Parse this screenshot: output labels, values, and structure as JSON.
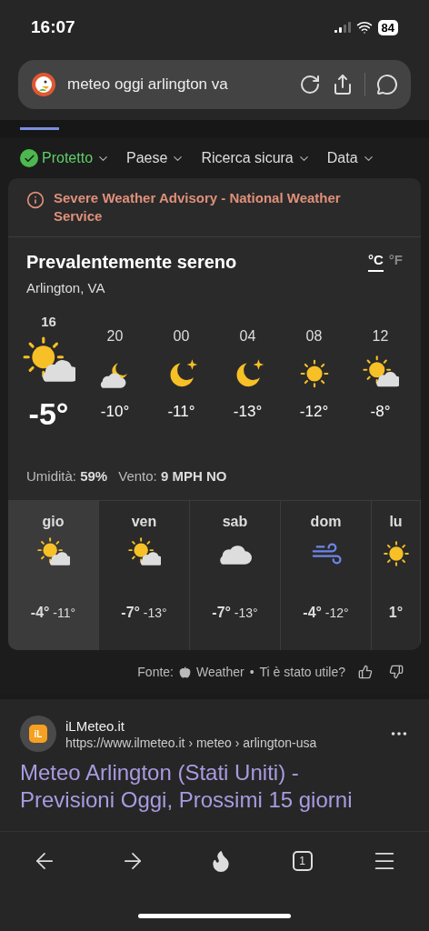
{
  "status_bar": {
    "time": "16:07",
    "battery": "84"
  },
  "address_bar": {
    "query": "meteo oggi arlington va"
  },
  "filters": [
    {
      "label": "Protetto",
      "kind": "protected"
    },
    {
      "label": "Paese",
      "kind": "plain"
    },
    {
      "label": "Ricerca sicura",
      "kind": "plain"
    },
    {
      "label": "Data",
      "kind": "plain"
    }
  ],
  "weather": {
    "alert": "Severe Weather Advisory - National Weather Service",
    "condition": "Prevalentemente sereno",
    "location": "Arlington, VA",
    "units": [
      {
        "label": "°C",
        "selected": true
      },
      {
        "label": "°F",
        "selected": false
      }
    ],
    "hourly": [
      {
        "time": "16",
        "kind": "partly-sunny",
        "temp": "-5°",
        "current": true
      },
      {
        "time": "20",
        "kind": "night-cloudy",
        "temp": "-10°",
        "current": false
      },
      {
        "time": "00",
        "kind": "moon-star",
        "temp": "-11°",
        "current": false
      },
      {
        "time": "04",
        "kind": "moon-star",
        "temp": "-13°",
        "current": false
      },
      {
        "time": "08",
        "kind": "sun",
        "temp": "-12°",
        "current": false
      },
      {
        "time": "12",
        "kind": "partly-sunny",
        "temp": "-8°",
        "current": false
      }
    ],
    "humidity_label": "Umidità:",
    "humidity": "59%",
    "wind_label": "Vento:",
    "wind": "9 MPH NO",
    "days": [
      {
        "day": "gio",
        "kind": "partly-sunny",
        "high": "-4°",
        "low": "-11°",
        "selected": true
      },
      {
        "day": "ven",
        "kind": "partly-sunny",
        "high": "-7°",
        "low": "-13°",
        "selected": false
      },
      {
        "day": "sab",
        "kind": "cloud",
        "high": "-7°",
        "low": "-13°",
        "selected": false
      },
      {
        "day": "dom",
        "kind": "wind",
        "high": "-4°",
        "low": "-12°",
        "selected": false
      },
      {
        "day": "lu",
        "kind": "sun",
        "high": "1°",
        "selected": false
      }
    ]
  },
  "source": {
    "label": "Fonte:",
    "provider": "Weather",
    "separator": "•",
    "feedback": "Ti è stato utile?"
  },
  "result": {
    "site": "iLMeteo.it",
    "url": "https://www.ilmeteo.it › meteo › arlington-usa",
    "title": "Meteo Arlington (Stati Uniti) - Previsioni Oggi, Prossimi 15 giorni",
    "logo": "iL"
  },
  "bottom_nav": {
    "tab_count": "1"
  }
}
